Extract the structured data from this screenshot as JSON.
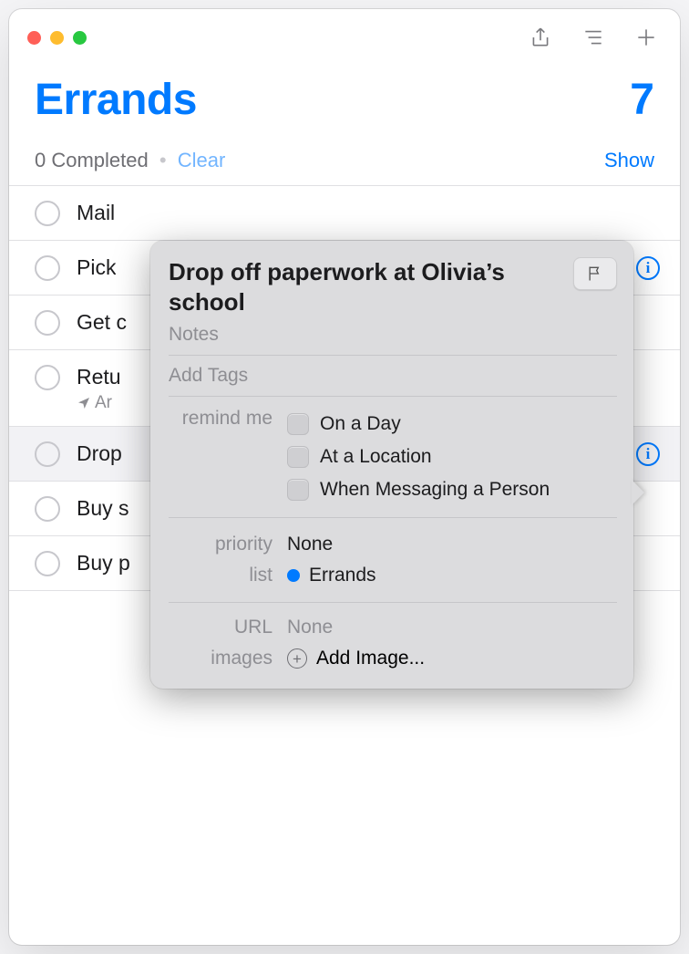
{
  "header": {
    "title": "Errands",
    "count": "7",
    "completed_text": "0 Completed",
    "clear_label": "Clear",
    "show_label": "Show"
  },
  "rows": [
    {
      "title": "Mail",
      "sub": ""
    },
    {
      "title": "Pick",
      "sub": ""
    },
    {
      "title": "Get c",
      "sub": ""
    },
    {
      "title": "Retu",
      "sub": "Ar"
    },
    {
      "title": "Drop",
      "sub": ""
    },
    {
      "title": "Buy s",
      "sub": ""
    },
    {
      "title": "Buy p",
      "sub": ""
    }
  ],
  "popover": {
    "title": "Drop off paperwork at Olivia’s school",
    "notes_placeholder": "Notes",
    "tags_placeholder": "Add Tags",
    "remind_label": "remind me",
    "remind_options": {
      "day": "On a Day",
      "location": "At a Location",
      "messaging": "When Messaging a Person"
    },
    "priority_label": "priority",
    "priority_value": "None",
    "list_label": "list",
    "list_value": "Errands",
    "url_label": "URL",
    "url_value": "None",
    "images_label": "images",
    "add_image_label": "Add Image..."
  }
}
